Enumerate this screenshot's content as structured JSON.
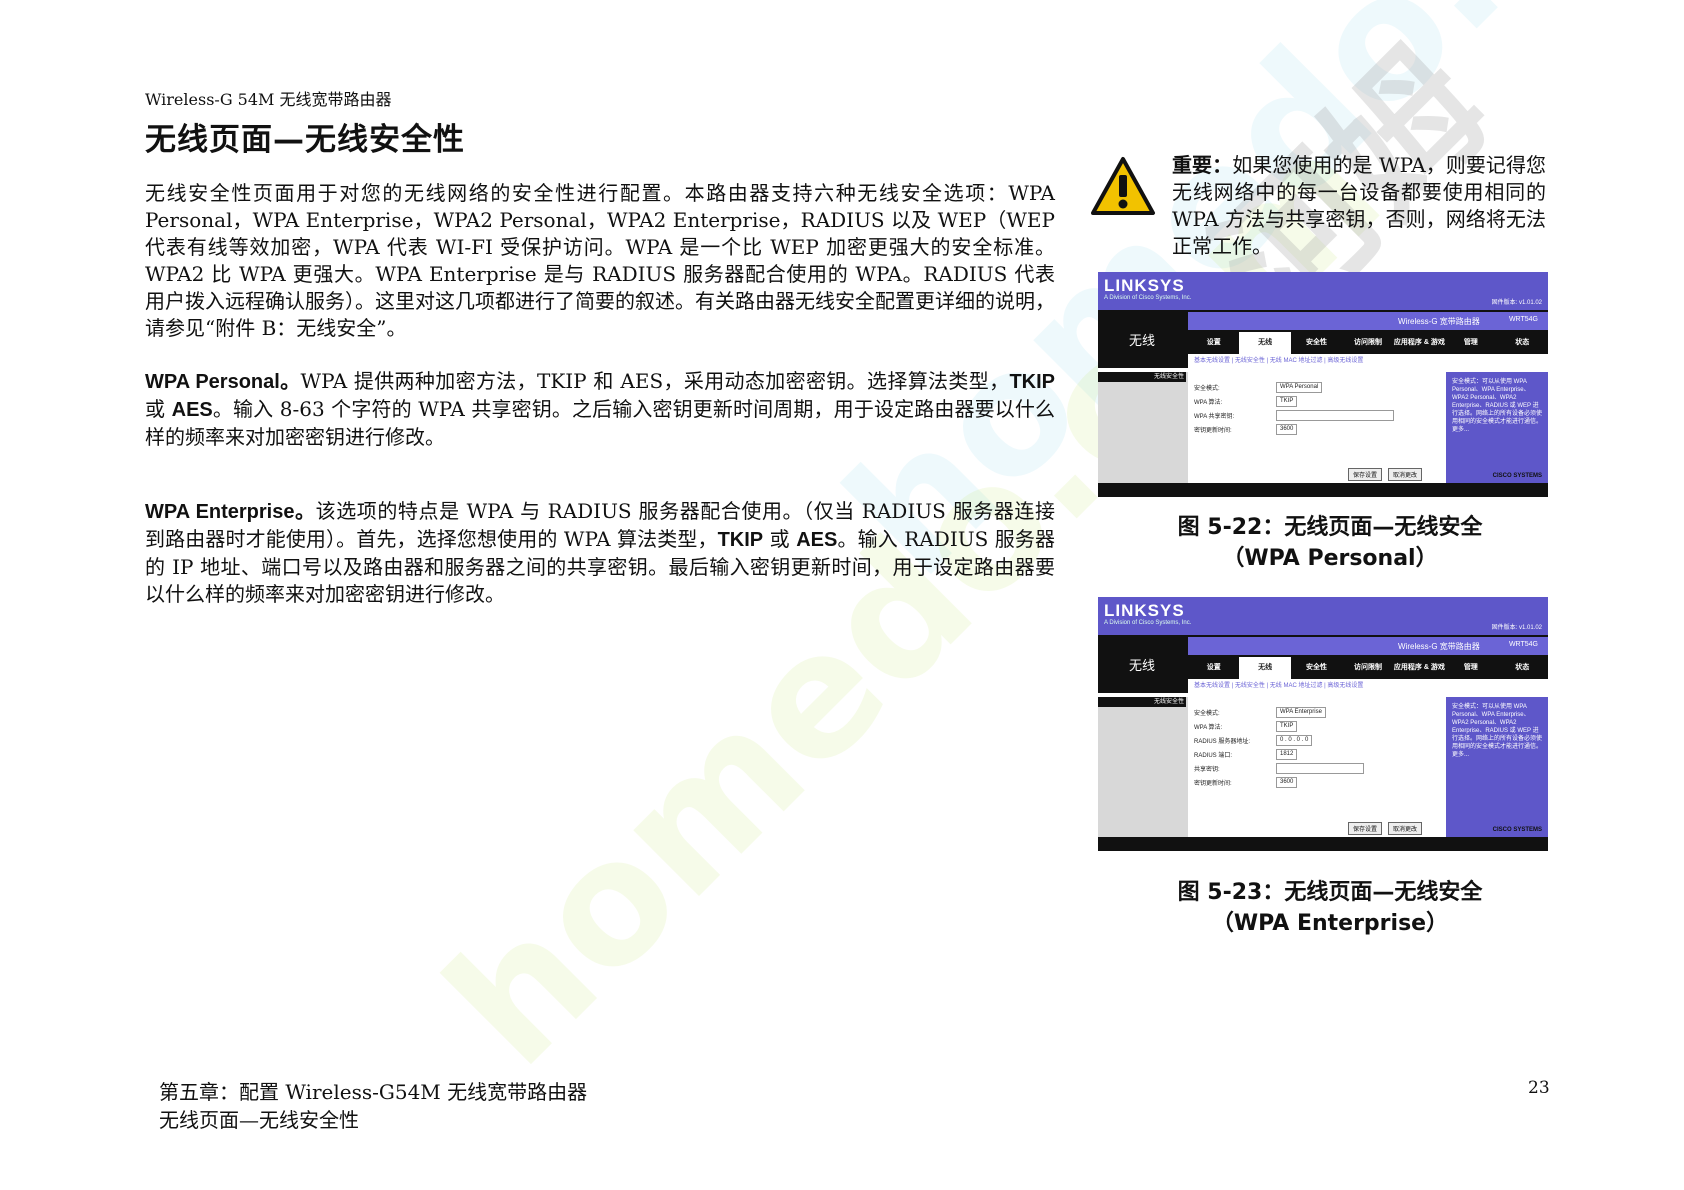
{
  "header": {
    "product": "Wireless-G 54M 无线宽带路由器",
    "title": "无线页面—无线安全性"
  },
  "paragraphs": {
    "intro": "无线安全性页面用于对您的无线网络的安全性进行配置。本路由器支持六种无线安全选项：WPA Personal，WPA Enterprise，WPA2 Personal，WPA2 Enterprise，RADIUS 以及 WEP（WEP 代表有线等效加密，WPA 代表 WI-FI 受保护访问。WPA 是一个比 WEP 加密更强大的安全标准。WPA2 比 WPA 更强大。WPA Enterprise 是与 RADIUS 服务器配合使用的 WPA。RADIUS 代表用户拨入远程确认服务）。这里对这几项都进行了简要的叙述。有关路由器无线安全配置更详细的说明，请参见“附件 B：无线安全”。",
    "wpa_personal_label": "WPA Personal。",
    "wpa_personal_text_1": "WPA 提供两种加密方法，TKIP 和 AES，采用动态加密密钥。选择算法类型，",
    "tkip": "TKIP",
    "or": " 或 ",
    "aes": "AES",
    "wpa_personal_text_2": "。输入 8-63 个字符的 WPA 共享密钥。之后输入密钥更新时间周期，用于设定路由器要以什么样的频率来对加密密钥进行修改。",
    "wpa_enterprise_label": "WPA Enterprise。",
    "wpa_enterprise_text_1": "该选项的特点是 WPA 与 RADIUS 服务器配合使用。（仅当 RADIUS 服务器连接到路由器时才能使用）。首先，选择您想使用的 WPA 算法类型，",
    "wpa_enterprise_text_2": "。输入 RADIUS 服务器的 IP 地址、端口号以及路由器和服务器之间的共享密钥。最后输入密钥更新时间，用于设定路由器要以什么样的频率来对加密密钥进行修改。"
  },
  "warning": {
    "icon": "warning-triangle-icon",
    "label": "重要：",
    "text": "如果您使用的是 WPA，则要记得您无线网络中的每一台设备都要使用相同的 WPA 方法与共享密钥，否则，网络将无法正常工作。"
  },
  "figures": [
    {
      "caption_line1": "图 5-22：无线页面—无线安全",
      "caption_line2": "（WPA Personal）",
      "screenshot": {
        "logo": "LINKSYS",
        "logo_sub": "A Division of Cisco Systems, Inc.",
        "firmware": "固件版本: v1.01.02",
        "section": "无线",
        "product": "Wireless-G 宽带路由器",
        "model": "WRT54G",
        "tabs": [
          "设置",
          "无线",
          "安全性",
          "访问限制",
          "应用程序 & 游戏",
          "管理",
          "状态"
        ],
        "subtabs": "基本无线设置  |  无线安全性  |  无线 MAC 地址过滤  |  高级无线设置",
        "left_label": "无线安全性",
        "rows": [
          {
            "k": "安全模式:",
            "v": "WPA Personal"
          },
          {
            "k": "WPA 算法:",
            "v": "TKIP"
          },
          {
            "k": "WPA 共享密钥:",
            "v": ""
          },
          {
            "k": "密钥更新时间:",
            "v": "3600"
          }
        ],
        "help": "安全模式：可以从使用 WPA Personal、WPA Enterprise、WPA2 Personal、WPA2 Enterprise、RADIUS 或 WEP 进行选择。网络上的所有设备必须使用相同的安全模式才能进行通信。更多...",
        "save": "保存设置",
        "cancel": "取消更改",
        "cisco": "CISCO SYSTEMS"
      }
    },
    {
      "caption_line1": "图 5-23：无线页面—无线安全",
      "caption_line2": "（WPA Enterprise）",
      "screenshot": {
        "logo": "LINKSYS",
        "logo_sub": "A Division of Cisco Systems, Inc.",
        "firmware": "固件版本: v1.01.02",
        "section": "无线",
        "product": "Wireless-G 宽带路由器",
        "model": "WRT54G",
        "tabs": [
          "设置",
          "无线",
          "安全性",
          "访问限制",
          "应用程序 & 游戏",
          "管理",
          "状态"
        ],
        "subtabs": "基本无线设置  |  无线安全性  |  无线 MAC 地址过滤  |  高级无线设置",
        "left_label": "无线安全性",
        "rows": [
          {
            "k": "安全模式:",
            "v": "WPA Enterprise"
          },
          {
            "k": "WPA 算法:",
            "v": "TKIP"
          },
          {
            "k": "RADIUS 服务器地址:",
            "v": "0 . 0 . 0 . 0"
          },
          {
            "k": "RADIUS 端口:",
            "v": "1812"
          },
          {
            "k": "共享密钥:",
            "v": ""
          },
          {
            "k": "密钥更新时间:",
            "v": "3600"
          }
        ],
        "help": "安全模式：可以从使用 WPA Personal、WPA Enterprise、WPA2 Personal、WPA2 Enterprise、RADIUS 或 WEP 进行选择。网络上的所有设备必须使用相同的安全模式才能进行通信。更多...",
        "save": "保存设置",
        "cancel": "取消更改",
        "cisco": "CISCO SYSTEMS"
      }
    }
  ],
  "footer": {
    "line1": "第五章：配置 Wireless-G54M 无线宽带路由器",
    "line2": "无线页面—无线安全性",
    "page": "23"
  },
  "watermark": {
    "text1": "homedo.com",
    "text2": "homedo.com",
    "text3": "河姆渡"
  }
}
